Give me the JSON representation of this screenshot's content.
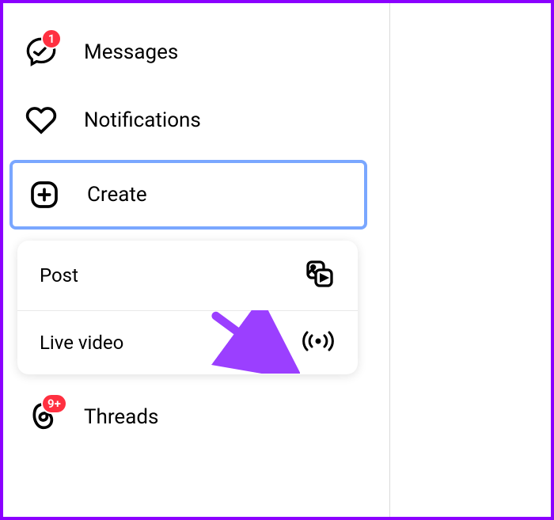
{
  "nav": {
    "messages": {
      "label": "Messages",
      "badge": "1"
    },
    "notifications": {
      "label": "Notifications"
    },
    "create": {
      "label": "Create"
    },
    "threads": {
      "label": "Threads",
      "badge": "9+"
    }
  },
  "create_menu": {
    "post": {
      "label": "Post"
    },
    "live": {
      "label": "Live video"
    }
  },
  "annotation": {
    "arrow_color": "#9b3fff"
  }
}
